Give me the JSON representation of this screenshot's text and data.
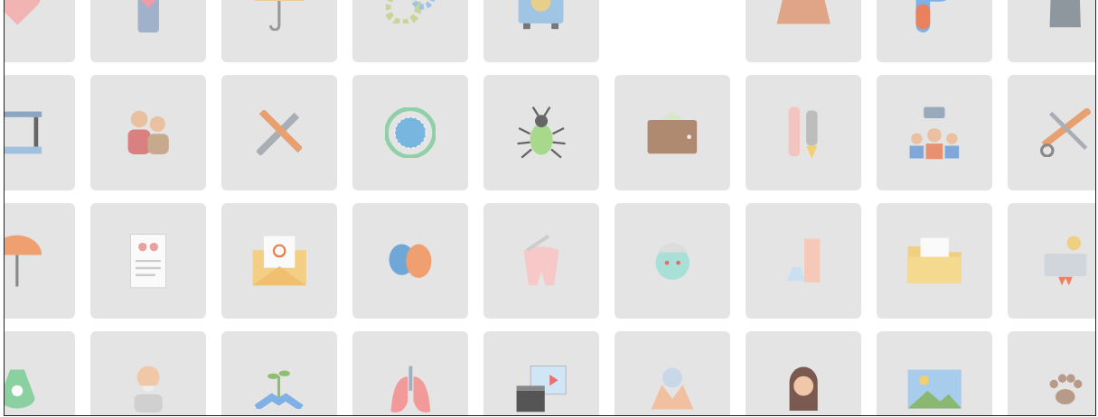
{
  "tile_rows": [
    {
      "tiles": [
        {
          "kind": "icon"
        },
        {
          "kind": "icon"
        },
        {
          "kind": "icon"
        },
        {
          "kind": "icon"
        },
        {
          "kind": "icon"
        },
        {
          "kind": "blank"
        },
        {
          "kind": "icon"
        },
        {
          "kind": "icon"
        },
        {
          "kind": "icon"
        }
      ]
    },
    {
      "tiles": [
        {
          "kind": "icon"
        },
        {
          "kind": "icon"
        },
        {
          "kind": "icon"
        },
        {
          "kind": "icon"
        },
        {
          "kind": "icon"
        },
        {
          "kind": "icon"
        },
        {
          "kind": "icon"
        },
        {
          "kind": "icon"
        },
        {
          "kind": "icon"
        }
      ]
    },
    {
      "tiles": [
        {
          "kind": "icon"
        },
        {
          "kind": "icon"
        },
        {
          "kind": "icon"
        },
        {
          "kind": "icon"
        },
        {
          "kind": "icon"
        },
        {
          "kind": "icon"
        },
        {
          "kind": "icon"
        },
        {
          "kind": "icon"
        },
        {
          "kind": "icon"
        }
      ]
    },
    {
      "tiles": [
        {
          "kind": "icon"
        },
        {
          "kind": "icon"
        },
        {
          "kind": "icon"
        },
        {
          "kind": "icon"
        },
        {
          "kind": "icon"
        },
        {
          "kind": "icon"
        },
        {
          "kind": "icon"
        },
        {
          "kind": "icon"
        },
        {
          "kind": "icon"
        }
      ]
    }
  ]
}
